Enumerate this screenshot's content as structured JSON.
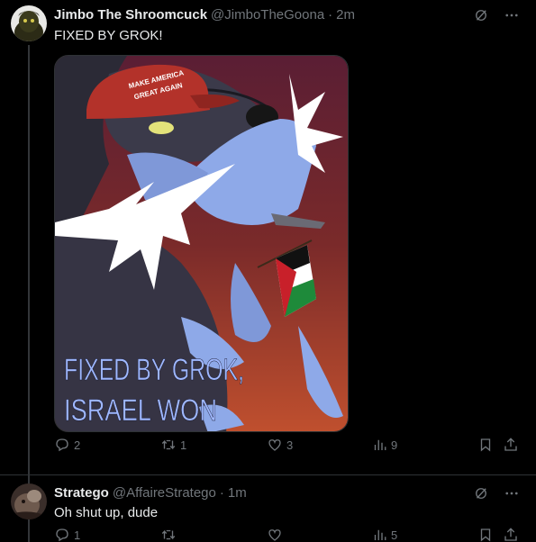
{
  "tweets": [
    {
      "name": "Jimbo The Shroomcuck",
      "handle": "@JimboTheGoona",
      "dot": "·",
      "time": "2m",
      "text": "FIXED BY GROK!",
      "media": {
        "hat_line1": "MAKE AMERICA",
        "hat_line2": "GREAT AGAIN",
        "caption_line1": "FIXED BY GROK,",
        "caption_line2": "ISRAEL WON"
      },
      "stats": {
        "replies": "2",
        "retweets": "1",
        "likes": "3",
        "views": "9"
      }
    },
    {
      "name": "Stratego",
      "handle": "@AffaireStratego",
      "dot": "·",
      "time": "1m",
      "text": "Oh shut up, dude",
      "stats": {
        "replies": "1",
        "retweets": "",
        "likes": "",
        "views": "5"
      }
    }
  ],
  "colors": {
    "background": "#000000",
    "text": "#e7e9ea",
    "muted": "#71767b",
    "divider": "#2f3336"
  },
  "icons": [
    "grok-icon",
    "more-icon",
    "reply-icon",
    "retweet-icon",
    "like-icon",
    "views-icon",
    "bookmark-icon",
    "share-icon"
  ]
}
